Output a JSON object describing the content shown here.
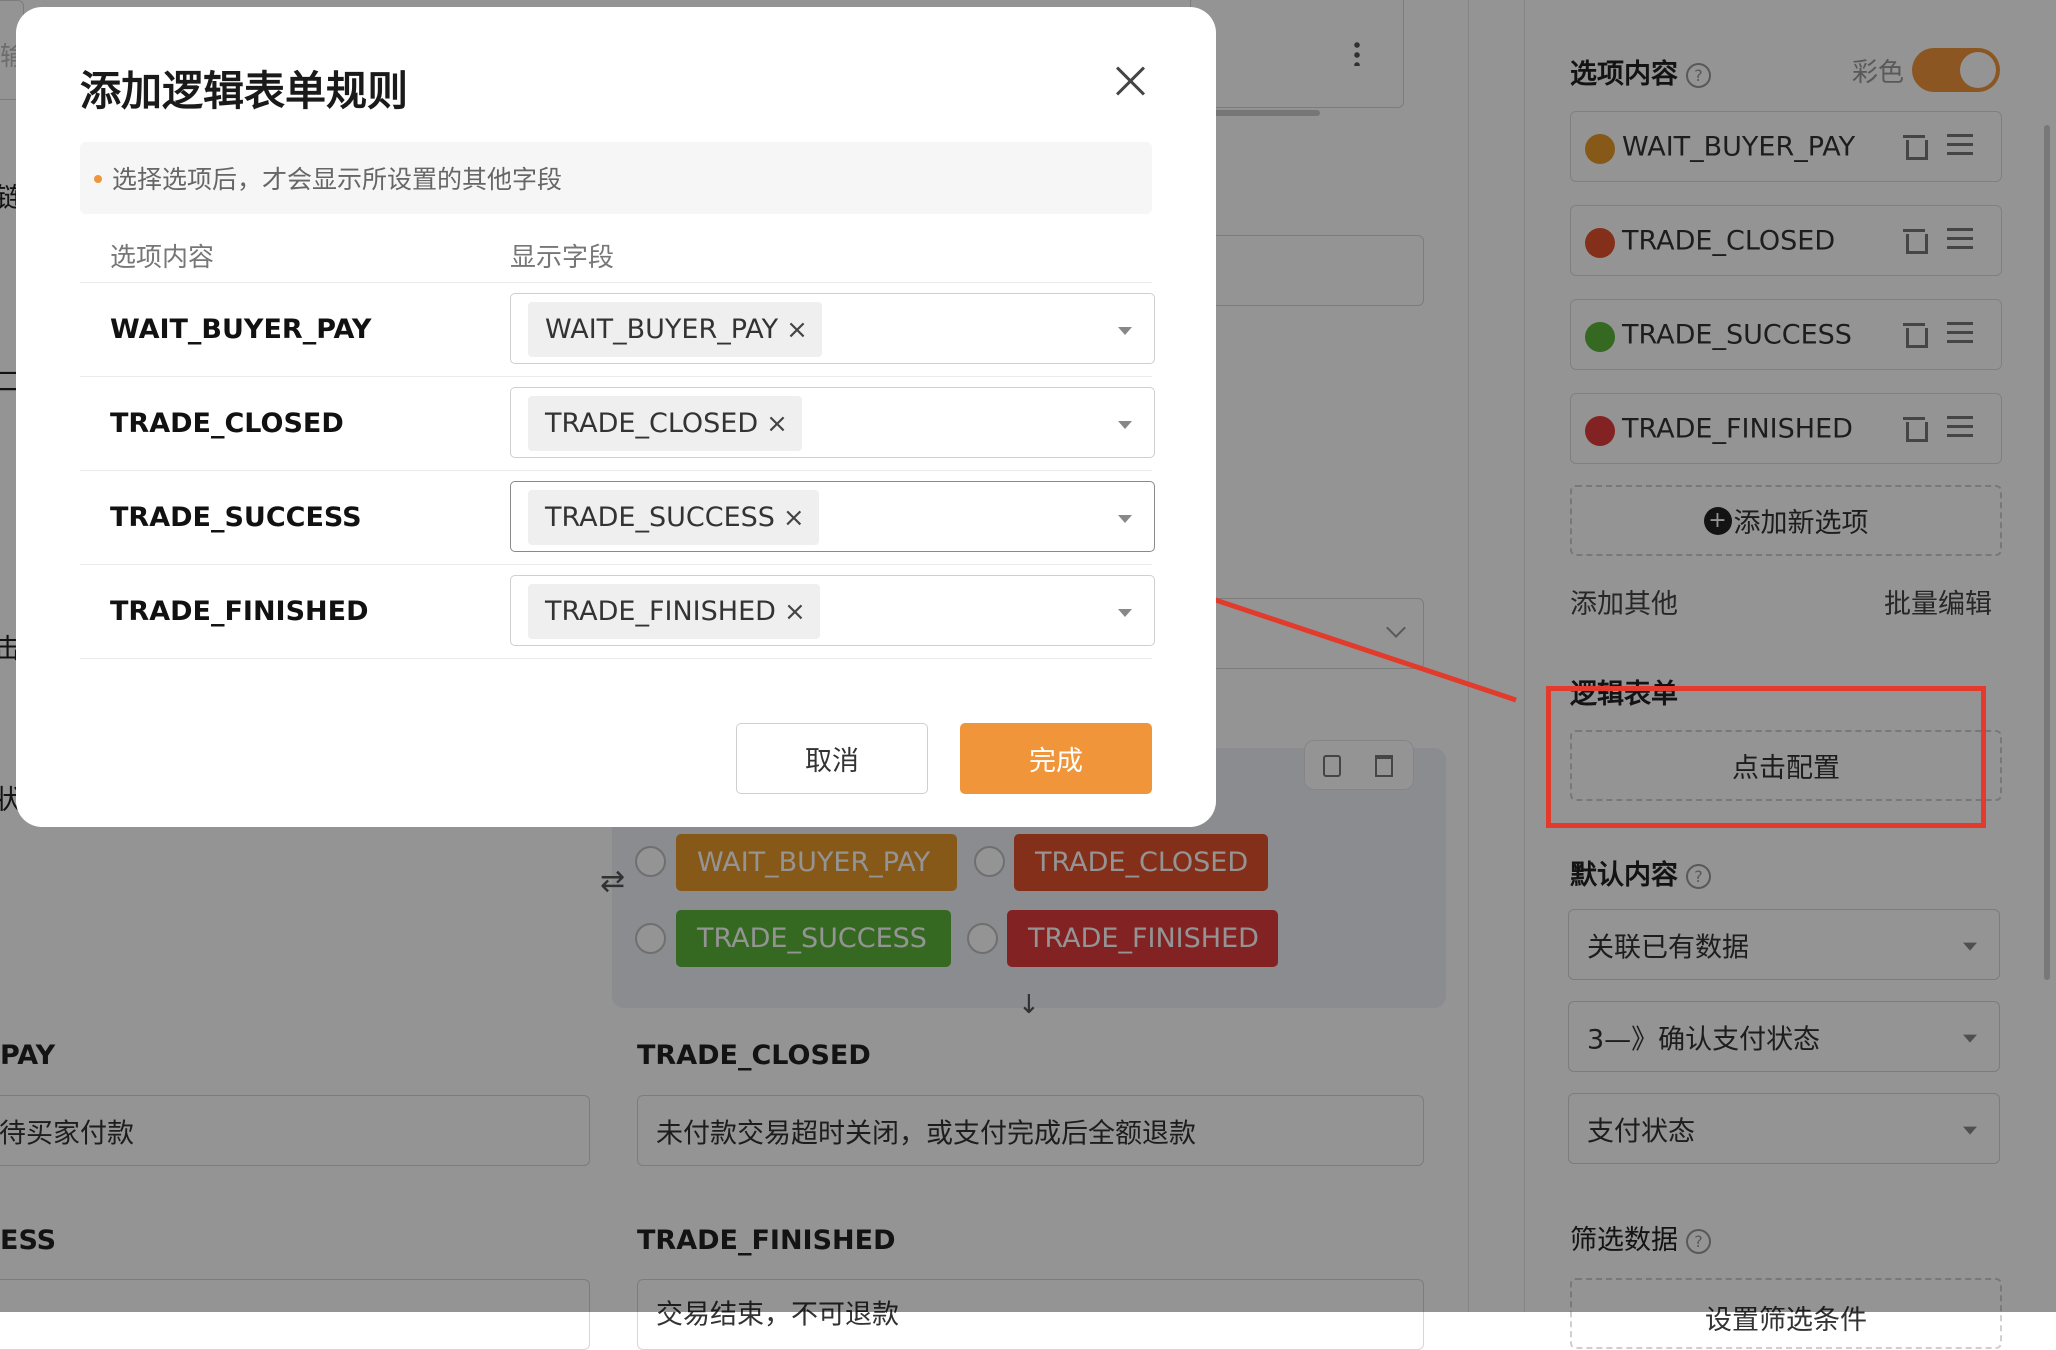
{
  "background": {
    "top_field_placeholder_fragment": "输",
    "left_fragments": [
      "链",
      "二",
      "击",
      "状"
    ],
    "fields": [
      {
        "label": "PAY",
        "value": "待买家付款"
      },
      {
        "label": "TRADE_CLOSED",
        "value": "未付款交易超时关闭，或支付完成后全额退款"
      },
      {
        "label": "ESS",
        "value": ""
      },
      {
        "label": "TRADE_FINISHED",
        "value": "交易结束，不可退款"
      }
    ],
    "option_tags": [
      {
        "label": "WAIT_BUYER_PAY",
        "color": "#e89a2c"
      },
      {
        "label": "TRADE_CLOSED",
        "color": "#e2512c"
      },
      {
        "label": "TRADE_SUCCESS",
        "color": "#5cb53a"
      },
      {
        "label": "TRADE_FINISHED",
        "color": "#e23b3b"
      }
    ]
  },
  "right_panel": {
    "options_title": "选项内容",
    "color_toggle_label": "彩色",
    "toggle_on": true,
    "options": [
      {
        "label": "WAIT_BUYER_PAY",
        "color": "#e89a2c"
      },
      {
        "label": "TRADE_CLOSED",
        "color": "#e2512c"
      },
      {
        "label": "TRADE_SUCCESS",
        "color": "#5cb53a"
      },
      {
        "label": "TRADE_FINISHED",
        "color": "#e23b3b"
      }
    ],
    "add_option_label": "添加新选项",
    "add_other_label": "添加其他",
    "batch_edit_label": "批量编辑",
    "logic_form_title": "逻辑表单",
    "configure_button_label": "点击配置",
    "default_content_title": "默认内容",
    "default_selects": [
      "关联已有数据",
      "3—》确认支付状态",
      "支付状态"
    ],
    "filter_title": "筛选数据",
    "filter_button_label": "设置筛选条件"
  },
  "modal": {
    "title": "添加逻辑表单规则",
    "notice": "选择选项后，才会显示所设置的其他字段",
    "col_option": "选项内容",
    "col_fields": "显示字段",
    "rows": [
      {
        "option": "WAIT_BUYER_PAY",
        "field": "WAIT_BUYER_PAY"
      },
      {
        "option": "TRADE_CLOSED",
        "field": "TRADE_CLOSED"
      },
      {
        "option": "TRADE_SUCCESS",
        "field": "TRADE_SUCCESS"
      },
      {
        "option": "TRADE_FINISHED",
        "field": "TRADE_FINISHED"
      }
    ],
    "cancel_label": "取消",
    "ok_label": "完成"
  },
  "annotation": {
    "color": "#e23b2c"
  }
}
